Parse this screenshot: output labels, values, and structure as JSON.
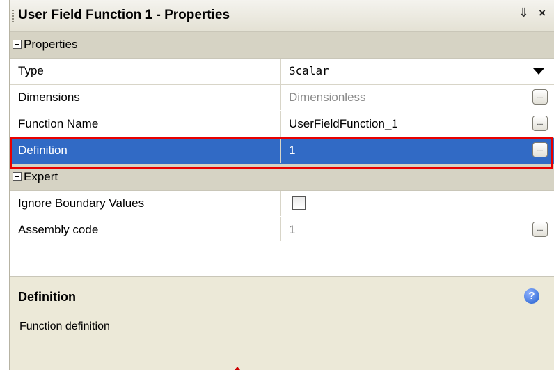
{
  "window": {
    "title": "User Field Function 1 - Properties",
    "pin_icon": "pin-icon",
    "close_label": "×"
  },
  "categories": {
    "properties": "Properties",
    "expert": "Expert"
  },
  "rows": {
    "type": {
      "name": "Type",
      "value": "Scalar"
    },
    "dimensions": {
      "name": "Dimensions",
      "value": "Dimensionless"
    },
    "function_name": {
      "name": "Function Name",
      "value": "UserFieldFunction_1"
    },
    "definition": {
      "name": "Definition",
      "value": "1"
    },
    "ignore_boundary": {
      "name": "Ignore Boundary Values",
      "checked": false
    },
    "assembly_code": {
      "name": "Assembly code",
      "value": "1"
    }
  },
  "ellipsis_label": "...",
  "help": {
    "title": "Definition",
    "description": "Function definition",
    "icon_label": "?"
  },
  "colors": {
    "selection": "#316ac5",
    "highlight": "#e80000",
    "panel_bg": "#ece9d8"
  }
}
